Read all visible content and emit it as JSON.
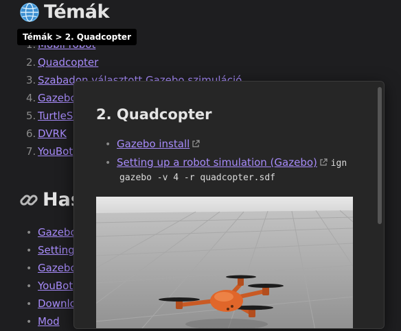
{
  "page": {
    "title": "Témák",
    "breadcrumb_tooltip": "Témák > 2. Quadcopter"
  },
  "topics": [
    {
      "num": "1.",
      "label": "Mobil robot"
    },
    {
      "num": "2.",
      "label": "Quadcopter"
    },
    {
      "num": "3.",
      "label": "Szabadon választott Gazebo szimuláció"
    },
    {
      "num": "4.",
      "label": "Gazebo"
    },
    {
      "num": "5.",
      "label": "TurtleSi"
    },
    {
      "num": "6.",
      "label": "DVRK"
    },
    {
      "num": "7.",
      "label": "YouBot"
    }
  ],
  "links_section": {
    "title": "Has",
    "items": [
      {
        "bullet": "•",
        "label": "Gazebo"
      },
      {
        "bullet": "•",
        "label": "Setting"
      },
      {
        "bullet": "•",
        "label": "Gazebo"
      },
      {
        "bullet": "•",
        "label": "YouBot"
      },
      {
        "bullet": "•",
        "label": "Downlo"
      },
      {
        "bullet": "•",
        "label": "Mod"
      }
    ]
  },
  "popup": {
    "title": "2. Quadcopter",
    "items": [
      {
        "bullet": "•",
        "label": "Gazebo install"
      },
      {
        "bullet": "•",
        "label": "Setting up a robot simulation (Gazebo)",
        "code_inline": "ign"
      }
    ],
    "command_cont": "gazebo -v 4 -r quadcopter.sdf"
  },
  "colors": {
    "background": "#1e1e20",
    "link": "#a78bfa",
    "text": "#d4d4d4",
    "popup_bg": "#262626",
    "drone_orange": "#e0662a"
  },
  "icons": {
    "heading": "globe-icon",
    "links_heading": "link-icon",
    "external": "external-link-icon"
  }
}
